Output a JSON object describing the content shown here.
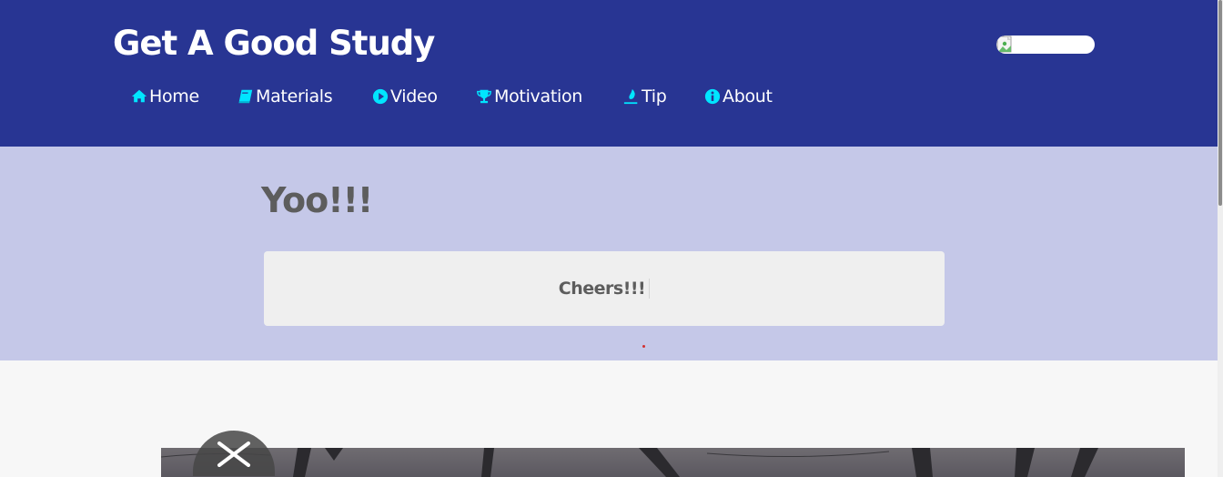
{
  "site": {
    "brand": "Get A Good Study"
  },
  "nav": {
    "items": [
      {
        "label": "Home",
        "icon": "home-icon"
      },
      {
        "label": "Materials",
        "icon": "book-icon"
      },
      {
        "label": "Video",
        "icon": "play-circle-icon"
      },
      {
        "label": "Motivation",
        "icon": "trophy-icon"
      },
      {
        "label": "Tip",
        "icon": "pen-tip-icon"
      },
      {
        "label": "About",
        "icon": "info-circle-icon"
      }
    ]
  },
  "hero": {
    "title": "Yoo!!!",
    "card_text": "Cheers!!!"
  },
  "colors": {
    "header_bg": "#283593",
    "nav_icon": "#00e5ff",
    "hero_bg": "#c5c8e8",
    "card_bg": "#efefef",
    "text_dark": "#5d5d5d"
  }
}
